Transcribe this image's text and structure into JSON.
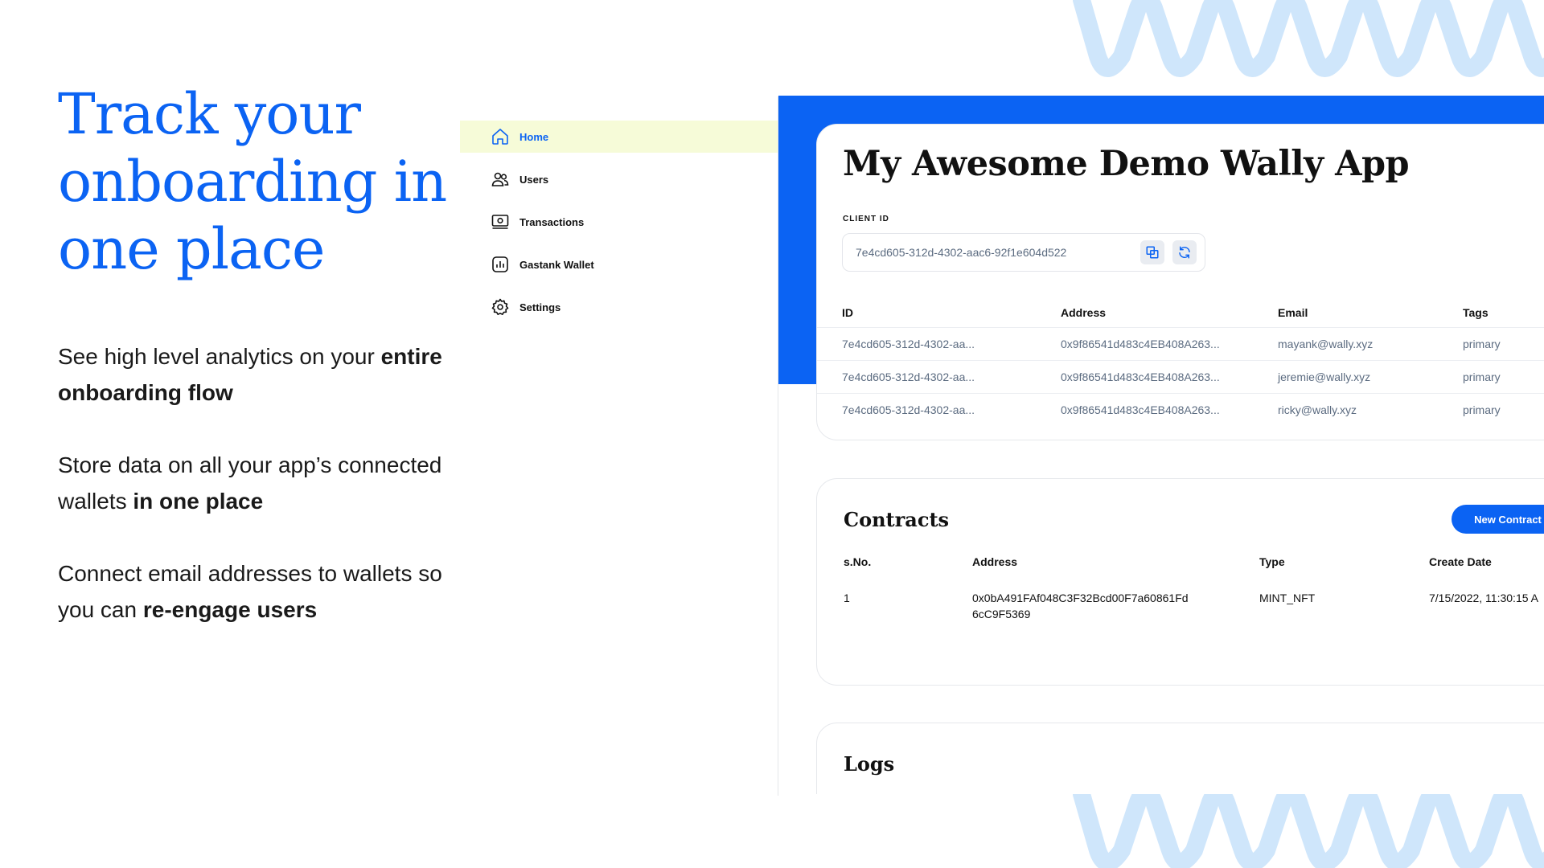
{
  "hero": {
    "title": "Track your onboarding in one place",
    "features": [
      {
        "text": "See high level analytics on your ",
        "bold": "entire onboarding flow"
      },
      {
        "text": "Store data on all your app’s connected wallets ",
        "bold": "in one place"
      },
      {
        "text": "Connect email addresses to wallets so you can ",
        "bold": "re-engage users"
      }
    ]
  },
  "sidebar": {
    "items": [
      {
        "label": "Home",
        "icon": "home-icon"
      },
      {
        "label": "Users",
        "icon": "users-icon"
      },
      {
        "label": "Transactions",
        "icon": "transactions-icon"
      },
      {
        "label": "Gastank Wallet",
        "icon": "wallet-chart-icon"
      },
      {
        "label": "Settings",
        "icon": "gear-icon"
      }
    ]
  },
  "app": {
    "title": "My Awesome Demo Wally App",
    "client_id_label": "CLIENT ID",
    "client_id": "7e4cd605-312d-4302-aac6-92f1e604d522",
    "users_table": {
      "headers": [
        "ID",
        "Address",
        "Email",
        "Tags"
      ],
      "rows": [
        [
          "7e4cd605-312d-4302-aa...",
          "0x9f86541d483c4EB408A263...",
          "mayank@wally.xyz",
          "primary"
        ],
        [
          "7e4cd605-312d-4302-aa...",
          "0x9f86541d483c4EB408A263...",
          "jeremie@wally.xyz",
          "primary"
        ],
        [
          "7e4cd605-312d-4302-aa...",
          "0x9f86541d483c4EB408A263...",
          "ricky@wally.xyz",
          "primary"
        ]
      ]
    }
  },
  "contracts": {
    "title": "Contracts",
    "new_button": "New Contract",
    "headers": [
      "s.No.",
      "Address",
      "Type",
      "Create Date"
    ],
    "rows": [
      [
        "1",
        "0x0bA491FAf048C3F32Bcd00F7a60861Fd6cC9F5369",
        "MINT_NFT",
        "7/15/2022, 11:30:15 A"
      ]
    ]
  },
  "logs": {
    "title": "Logs"
  },
  "colors": {
    "accent": "#0b63f3",
    "active_bg": "#f6fbd8",
    "wave": "#cfe6fb"
  }
}
